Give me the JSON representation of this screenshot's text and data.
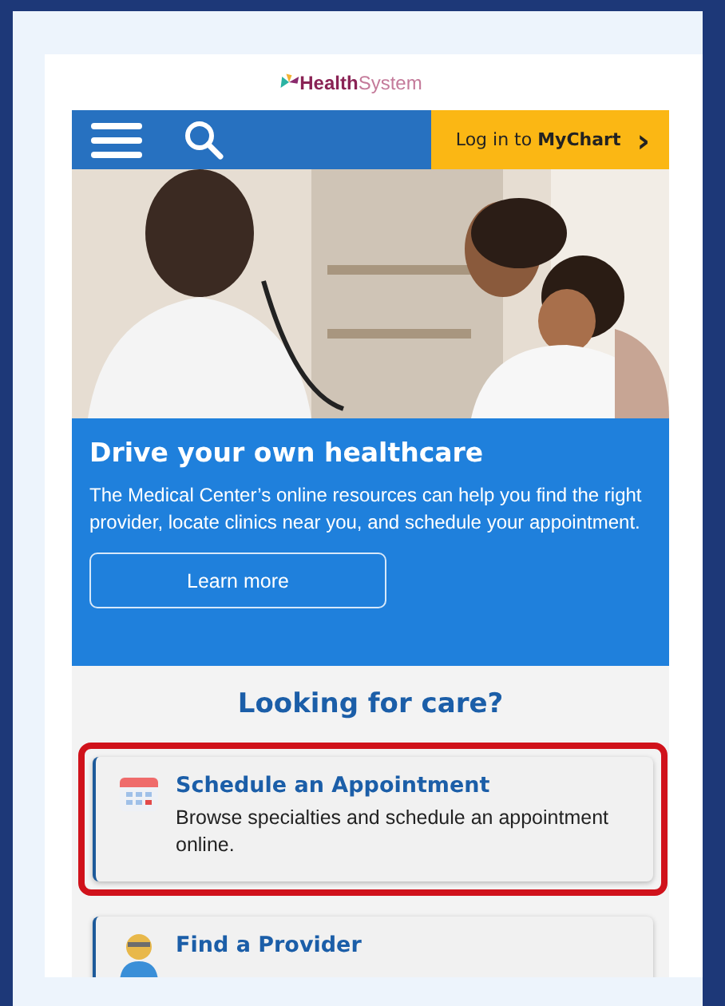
{
  "logo": {
    "bold": "Health",
    "light": "System"
  },
  "nav": {
    "login_prefix": "Log in to",
    "login_bold": "MyChart",
    "chevron": "›"
  },
  "hero": {
    "title": "Drive your own healthcare",
    "text": "The Medical Center’s online resources can help you find the right provider, locate clinics near you, and schedule your appointment.",
    "button": "Learn more"
  },
  "care": {
    "heading": "Looking for care?",
    "cards": [
      {
        "kind": "calendar",
        "title": "Schedule an Appointment",
        "text": "Browse specialties and schedule an appointment online.",
        "highlighted": true
      },
      {
        "kind": "person",
        "title": "Find a Provider",
        "highlighted": false
      }
    ]
  }
}
